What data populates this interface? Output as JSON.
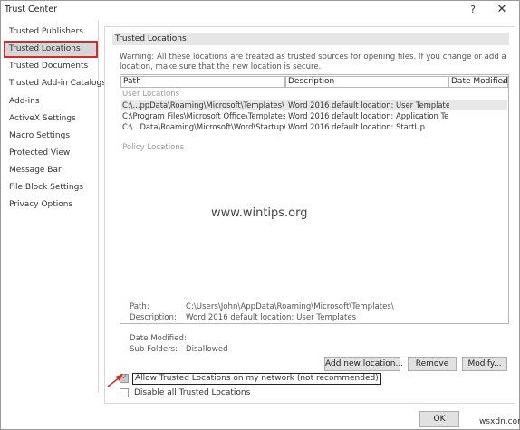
{
  "window": {
    "title": "Trust Center",
    "help": "?",
    "close": "✕"
  },
  "sidebar": {
    "items": [
      {
        "label": "Trusted Publishers",
        "selected": false
      },
      {
        "label": "Trusted Locations",
        "selected": true
      },
      {
        "label": "Trusted Documents",
        "selected": false
      },
      {
        "label": "Trusted Add-in Catalogs",
        "selected": false
      },
      {
        "label": "Add-ins",
        "selected": false
      },
      {
        "label": "ActiveX Settings",
        "selected": false
      },
      {
        "label": "Macro Settings",
        "selected": false
      },
      {
        "label": "Protected View",
        "selected": false
      },
      {
        "label": "Message Bar",
        "selected": false
      },
      {
        "label": "File Block Settings",
        "selected": false
      },
      {
        "label": "Privacy Options",
        "selected": false
      }
    ]
  },
  "main": {
    "section_title": "Trusted Locations",
    "warning": "Warning: All these locations are treated as trusted sources for opening files.  If you change or add a location, make sure that the new location is secure.",
    "table": {
      "headers": [
        "Path",
        "Description",
        "Date Modified"
      ],
      "sort_arrow": "▾",
      "user_group_label": "User Locations",
      "policy_group_label": "Policy Locations",
      "rows": [
        {
          "path": "C:\\...ppData\\Roaming\\Microsoft\\Templates\\",
          "description": "Word 2016 default location: User Templates",
          "date": "",
          "selected": true
        },
        {
          "path": "C:\\Program Files\\Microsoft Office\\Templates\\",
          "description": "Word 2016 default location: Application Te...",
          "date": "",
          "selected": false
        },
        {
          "path": "C:\\...Data\\Roaming\\Microsoft\\Word\\Startup\\",
          "description": "Word 2016 default location: StartUp",
          "date": "",
          "selected": false
        }
      ]
    },
    "details": {
      "path_label": "Path:",
      "path_value": "C:\\Users\\John\\AppData\\Roaming\\Microsoft\\Templates\\",
      "description_label": "Description:",
      "description_value": "Word 2016 default location: User Templates",
      "date_label": "Date Modified:",
      "date_value": "",
      "subfolders_label": "Sub Folders:",
      "subfolders_value": "Disallowed"
    },
    "buttons": {
      "add": "Add new location...",
      "remove": "Remove",
      "modify": "Modify..."
    },
    "allow_network": {
      "label": "Allow Trusted Locations on my network (not recommended)",
      "checked": true
    },
    "disable_all": {
      "label": "Disable all Trusted Locations",
      "checked": false
    }
  },
  "footer": {
    "ok": "OK",
    "site_mark": "wsxdn.com"
  },
  "watermark": "www.wintips.org",
  "colors": {
    "highlight_border": "#d32a2a",
    "selected_bg": "#d6d6d6",
    "arrow": "#d32a2a"
  }
}
